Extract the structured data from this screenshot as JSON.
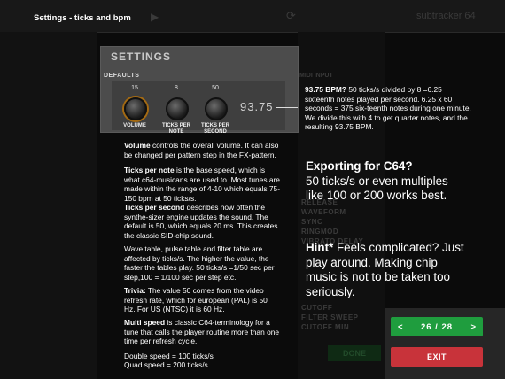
{
  "overlay_title": "Settings - ticks and bpm",
  "background_app": {
    "app_name": "subtracker 64",
    "sidebar_rows": [
      "RELEASE",
      "WAVEFORM",
      "SYNC",
      "RINGMOD",
      "VIBRATO DELAY"
    ],
    "filter_rows": [
      "CUTOFF",
      "FILTER SWEEP",
      "CUTOFF MIN"
    ],
    "midi_label": "MIDI INPUT",
    "done_label": "DONE"
  },
  "settings_panel": {
    "title": "SETTINGS",
    "defaults_label": "DEFAULTS",
    "knobs": [
      {
        "value": "15",
        "label": "VOLUME"
      },
      {
        "value": "8",
        "label": "TICKS PER NOTE"
      },
      {
        "value": "50",
        "label": "TICKS PER SECOND"
      }
    ],
    "bpm_display": "93.75"
  },
  "help_left": {
    "volume": {
      "bold": "Volume",
      "text": " controls the overall volume. It can also be changed per pattern step in the FX-pattern."
    },
    "ticks_per_note": {
      "bold": "Ticks per note",
      "text": " is the base speed, which is what c64-musicans are used to. Most tunes are made within the range of 4-10 which equals 75-150 bpm at 50 ticks/s."
    },
    "ticks_per_second": {
      "bold": "Ticks per second",
      "text": " describes how often the synthe-sizer engine updates the sound. The default is 50, which equals 20 ms. This creates the classic SID-chip sound."
    },
    "tables": "Wave table, pulse table and filter table are affected by ticks/s. The higher the value, the faster the tables play. 50 ticks/s =1/50 sec per step,100 = 1/100 sec per step etc.",
    "trivia": {
      "bold": "Trivia:",
      "text": " The value 50 comes from the video refresh rate, which for european (PAL) is 50 Hz. For US (NTSC) it is 60 Hz."
    },
    "multi_speed": {
      "bold": "Multi speed",
      "text": " is classic C64-terminology for a tune that calls the player routine more than one time per refresh cycle."
    },
    "double_speed": "Double speed = 100 ticks/s",
    "quad_speed": "Quad speed = 200 ticks/s"
  },
  "help_right": {
    "bpm": {
      "bold": "93.75 BPM?",
      "text": " 50 ticks/s divided by 8 =6.25 sixteenth notes played per second. 6.25 x 60 seconds = 375 six-teenth notes during one minute. We divide this with 4 to get quarter notes, and the resulting 93.75 BPM."
    },
    "export": {
      "bold": "Exporting for C64?",
      "text": "50 ticks/s or even multiples like 100 or 200 works best."
    },
    "hint": {
      "bold": "Hint*",
      "text": " Feels complicated? Just play around. Making chip music is not to be taken too seriously."
    }
  },
  "nav": {
    "prev_arrow": "<",
    "page": "26 / 28",
    "next_arrow": ">",
    "exit": "EXIT"
  },
  "colors": {
    "nav_green": "#1f9d3e",
    "exit_red": "#c8333a",
    "panel_gray": "#4c4c4c"
  }
}
